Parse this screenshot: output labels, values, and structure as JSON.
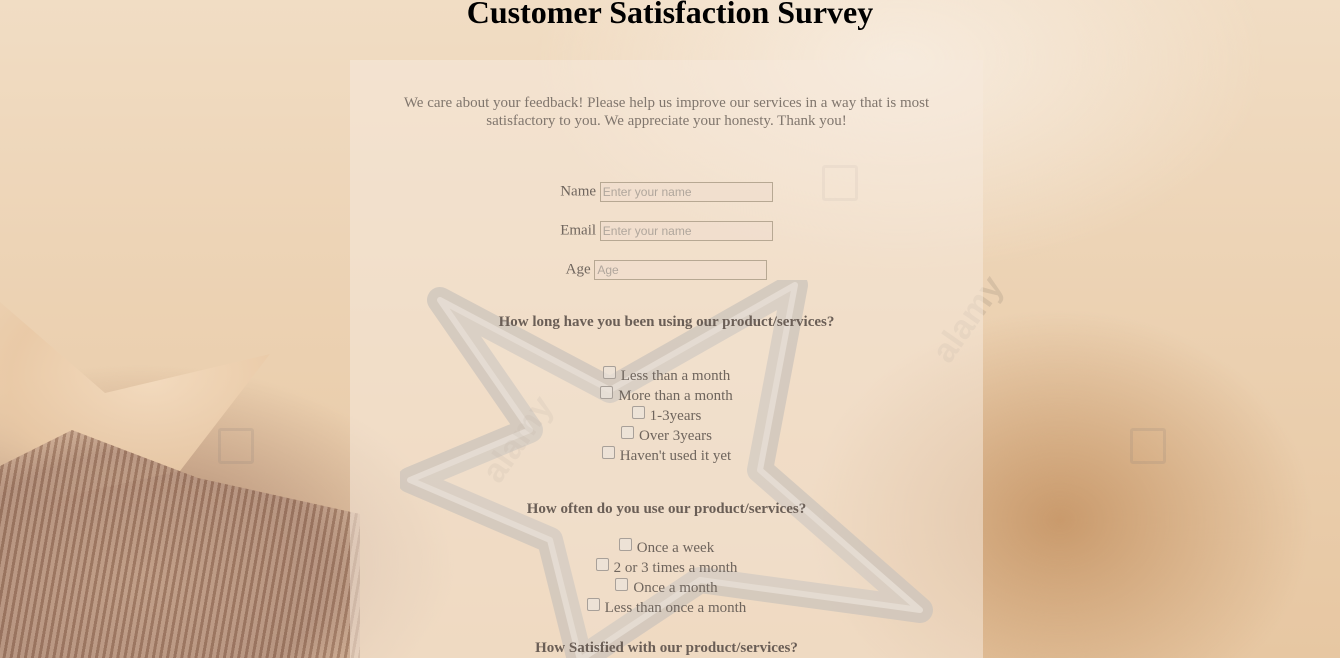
{
  "title": "Customer Satisfaction Survey",
  "intro": "We care about your feedback! Please help us improve our services in a way that is most satisfactory to you. We appreciate your honesty. Thank you!",
  "fields": {
    "name": {
      "label": "Name",
      "placeholder": "Enter your name",
      "value": ""
    },
    "email": {
      "label": "Email",
      "placeholder": "Enter your name",
      "value": ""
    },
    "age": {
      "label": "Age",
      "placeholder": "Age",
      "value": ""
    }
  },
  "questions": [
    {
      "text": "How long have you been using our product/services?",
      "options": [
        "Less than a month",
        "More than a month",
        "1-3years",
        "Over 3years",
        "Haven't used it yet"
      ]
    },
    {
      "text": "How often do you use our product/services?",
      "options": [
        "Once a week",
        "2 or 3 times a month",
        "Once a month",
        "Less than once a month"
      ]
    },
    {
      "text": "How Satisfied with our product/services?",
      "options": []
    }
  ]
}
